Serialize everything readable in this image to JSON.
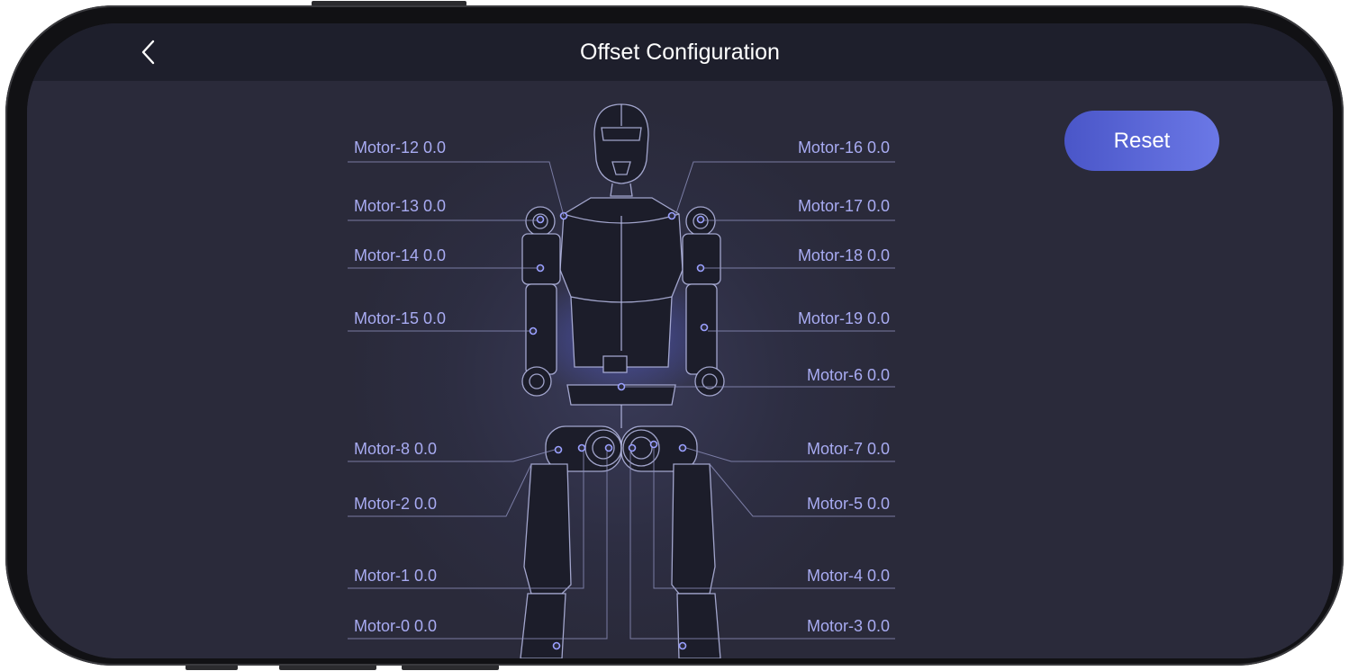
{
  "header": {
    "title": "Offset Configuration",
    "back_icon": "chevron-left-icon"
  },
  "actions": {
    "reset_label": "Reset"
  },
  "colors": {
    "accent": "#5b67dc",
    "label": "#a8abf2",
    "background": "#2a2a3a",
    "navbar": "#1e1f2c"
  },
  "motors_left": [
    {
      "label": "Motor-12 0.0"
    },
    {
      "label": "Motor-13 0.0"
    },
    {
      "label": "Motor-14 0.0"
    },
    {
      "label": "Motor-15 0.0"
    },
    {
      "label": "Motor-8 0.0"
    },
    {
      "label": "Motor-2 0.0"
    },
    {
      "label": "Motor-1 0.0"
    },
    {
      "label": "Motor-0 0.0"
    }
  ],
  "motors_right": [
    {
      "label": "Motor-16 0.0"
    },
    {
      "label": "Motor-17 0.0"
    },
    {
      "label": "Motor-18 0.0"
    },
    {
      "label": "Motor-19 0.0"
    },
    {
      "label": "Motor-6 0.0"
    },
    {
      "label": "Motor-7 0.0"
    },
    {
      "label": "Motor-5 0.0"
    },
    {
      "label": "Motor-4 0.0"
    },
    {
      "label": "Motor-3 0.0"
    }
  ]
}
